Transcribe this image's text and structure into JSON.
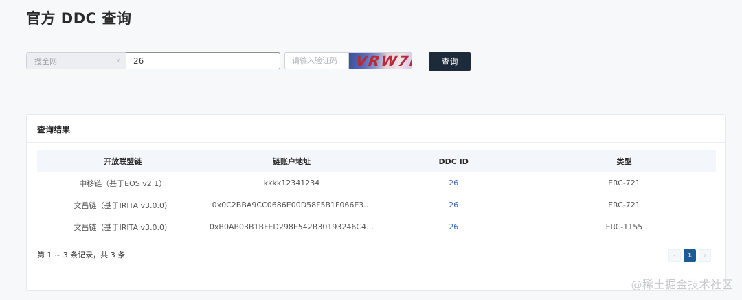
{
  "page": {
    "title": "官方 DDC 查询"
  },
  "search": {
    "scope_value": "搜全网",
    "query_value": "26",
    "captcha_placeholder": "请输入验证码",
    "captcha_text": "VRW7I",
    "button_label": "查询"
  },
  "results": {
    "title": "查询结果",
    "columns": [
      "开放联盟链",
      "链账户地址",
      "DDC ID",
      "类型"
    ],
    "rows": [
      {
        "chain": "中移链（基于EOS v2.1）",
        "address": "kkkk12341234",
        "ddc_id": "26",
        "type": "ERC-721"
      },
      {
        "chain": "文昌链（基于IRITA v3.0.0）",
        "address": "0x0C2BBA9CC0686E00D58F5B1F066E3…",
        "ddc_id": "26",
        "type": "ERC-721"
      },
      {
        "chain": "文昌链（基于IRITA v3.0.0）",
        "address": "0xB0AB03B1BFED298E542B30193246C4…",
        "ddc_id": "26",
        "type": "ERC-1155"
      }
    ],
    "summary": "第 1 ~ 3 条记录，共 3 条",
    "pagination": {
      "prev": "‹",
      "current": "1",
      "next": "›"
    }
  },
  "watermark": "@稀土掘金技术社区",
  "icons": {
    "scope_caret": "chevron-down-icon"
  },
  "colors": {
    "button_bg": "#1d2a3a",
    "active_page": "#1c5b93",
    "link": "#3c6fb3"
  }
}
